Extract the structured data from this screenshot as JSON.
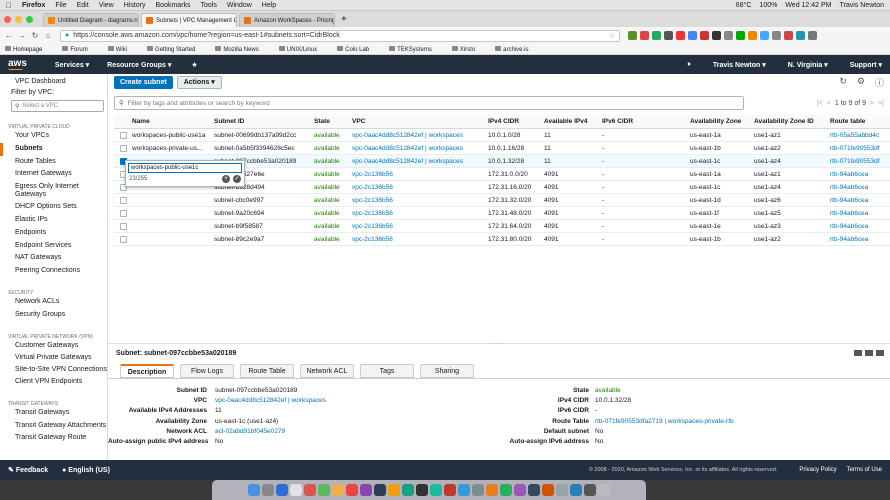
{
  "mac_menu": {
    "app": "Firefox",
    "items": [
      "File",
      "Edit",
      "View",
      "History",
      "Bookmarks",
      "Tools",
      "Window",
      "Help"
    ],
    "right": [
      "68°C",
      "100%",
      "Wed 12:42 PM",
      "Travis Newton"
    ]
  },
  "tabs": [
    {
      "label": "Untitled Diagram - diagrams.net",
      "color": "#f08705",
      "active": false
    },
    {
      "label": "Subnets | VPC Management Co",
      "color": "#ec7211",
      "active": true
    },
    {
      "label": "Amazon WorkSpaces - Pricing",
      "color": "#ec7211",
      "active": false
    }
  ],
  "url": "https://console.aws.amazon.com/vpc/home?region=us-east-1#subnets:sort=CidrBlock",
  "bookmarks": [
    "Homepage",
    "Forum",
    "Wiki",
    "Getting Started",
    "Mozilla News",
    "UNIX/Linux",
    "Colo Lab",
    "TEKSystems",
    "Xirsto",
    "archive.is"
  ],
  "aws_nav": {
    "services": "Services ▾",
    "resource_groups": "Resource Groups ▾",
    "user": "Travis Newton ▾",
    "region": "N. Virginia ▾",
    "support": "Support ▾"
  },
  "sidebar": {
    "dashboard": "VPC Dashboard",
    "filter_label": "Filter by VPC:",
    "select_placeholder": "Select a VPC",
    "sections": [
      {
        "title": "VIRTUAL PRIVATE CLOUD",
        "items": [
          {
            "label": "Your VPCs"
          },
          {
            "label": "Subnets",
            "active": true
          },
          {
            "label": "Route Tables"
          },
          {
            "label": "Internet Gateways"
          },
          {
            "label": "Egress Only Internet Gateways"
          },
          {
            "label": "DHCP Options Sets"
          },
          {
            "label": "Elastic IPs"
          },
          {
            "label": "Endpoints"
          },
          {
            "label": "Endpoint Services"
          },
          {
            "label": "NAT Gateways"
          },
          {
            "label": "Peering Connections"
          }
        ]
      },
      {
        "title": "SECURITY",
        "items": [
          {
            "label": "Network ACLs"
          },
          {
            "label": "Security Groups"
          }
        ]
      },
      {
        "title": "VIRTUAL PRIVATE NETWORK (VPN)",
        "items": [
          {
            "label": "Customer Gateways"
          },
          {
            "label": "Virtual Private Gateways"
          },
          {
            "label": "Site-to-Site VPN Connections"
          },
          {
            "label": "Client VPN Endpoints"
          }
        ]
      },
      {
        "title": "TRANSIT GATEWAYS",
        "items": [
          {
            "label": "Transit Gateways"
          },
          {
            "label": "Transit Gateway Attachments"
          },
          {
            "label": "Transit Gateway Route"
          }
        ]
      }
    ]
  },
  "actions": {
    "create": "Create subnet",
    "actions": "Actions ▾"
  },
  "search_placeholder": "Filter by tags and attributes or search by keyword",
  "pager": "1 to 9 of 9",
  "columns": [
    "Name",
    "Subnet ID",
    "State",
    "VPC",
    "IPv4 CIDR",
    "Available IPv4",
    "IPv6 CIDR",
    "Availability Zone",
    "Availability Zone ID",
    "Route table"
  ],
  "rows": [
    {
      "name": "workspaces-public-use1a",
      "id": "subnet-00699db137a99d2cc",
      "state": "available",
      "vpc": "vpc-0aac4dd8c512842ef | workspaces",
      "cidr": "10.0.1.0/28",
      "avail": "11",
      "ipv6": "-",
      "az": "us-east-1a",
      "azid": "use1-az1",
      "rt": "rtb-05a55abbd4c"
    },
    {
      "name": "workspaces-private-us...",
      "id": "subnet-0a5b5f3394628c5ec",
      "state": "available",
      "vpc": "vpc-0aac4dd8c512842ef | workspaces",
      "cidr": "10.0.1.16/28",
      "avail": "11",
      "ipv6": "-",
      "az": "us-east-1b",
      "azid": "use1-az2",
      "rt": "rtb-071fe90553df"
    },
    {
      "name": "",
      "id": "subnet-097ccbbe53a020189",
      "state": "available",
      "vpc": "vpc-0aac4dd8c512842ef | workspaces",
      "cidr": "10.0.1.32/28",
      "avail": "11",
      "ipv6": "-",
      "az": "us-east-1c",
      "azid": "use1-az4",
      "rt": "rtb-071fe90553df",
      "selected": true
    },
    {
      "name": "",
      "id": "subnet-29527e6e",
      "state": "available",
      "vpc": "vpc-2c136b56",
      "cidr": "172.31.0.0/20",
      "avail": "4091",
      "ipv6": "-",
      "az": "us-east-1a",
      "azid": "use1-az1",
      "rt": "rtb-94ab6cea"
    },
    {
      "name": "",
      "id": "subnet-d928d494",
      "state": "available",
      "vpc": "vpc-2c136b56",
      "cidr": "172.31.16.0/20",
      "avail": "4091",
      "ipv6": "-",
      "az": "us-east-1c",
      "azid": "use1-az4",
      "rt": "rtb-94ab6cea"
    },
    {
      "name": "",
      "id": "subnet-cbc0e997",
      "state": "available",
      "vpc": "vpc-2c136b56",
      "cidr": "172.31.32.0/20",
      "avail": "4091",
      "ipv6": "-",
      "az": "us-east-1d",
      "azid": "use1-az6",
      "rt": "rtb-94ab6cea"
    },
    {
      "name": "",
      "id": "subnet-9a20c694",
      "state": "available",
      "vpc": "vpc-2c136b56",
      "cidr": "172.31.48.0/20",
      "avail": "4091",
      "ipv6": "-",
      "az": "us-east-1f",
      "azid": "use1-az5",
      "rt": "rtb-94ab6cea"
    },
    {
      "name": "",
      "id": "subnet-b9f58587",
      "state": "available",
      "vpc": "vpc-2c136b56",
      "cidr": "172.31.64.0/20",
      "avail": "4091",
      "ipv6": "-",
      "az": "us-east-1e",
      "azid": "use1-az3",
      "rt": "rtb-94ab6cea"
    },
    {
      "name": "",
      "id": "subnet-89c2e9a7",
      "state": "available",
      "vpc": "vpc-2c136b56",
      "cidr": "172.31.80.0/20",
      "avail": "4091",
      "ipv6": "-",
      "az": "us-east-1b",
      "azid": "use1-az2",
      "rt": "rtb-94ab6cea"
    }
  ],
  "editor": {
    "value": "workspaces-public-use1c",
    "count": "23/255"
  },
  "detail": {
    "header": "Subnet: subnet-097ccbbe53a020189",
    "tabs": [
      "Description",
      "Flow Logs",
      "Route Table",
      "Network ACL",
      "Tags",
      "Sharing"
    ],
    "left": [
      {
        "k": "Subnet ID",
        "v": "subnet-097ccbbe53a020189"
      },
      {
        "k": "VPC",
        "v": "vpc-0aac4dd8c512842ef | workspaces",
        "link": true
      },
      {
        "k": "Available IPv4 Addresses",
        "v": "11"
      },
      {
        "k": "Availability Zone",
        "v": "us-east-1c (use1-az4)"
      },
      {
        "k": "Network ACL",
        "v": "acl-02abd91bf045e0279",
        "link": true
      },
      {
        "k": "Auto-assign public IPv4 address",
        "v": "No"
      }
    ],
    "right": [
      {
        "k": "State",
        "v": "available",
        "green": true
      },
      {
        "k": "IPv4 CIDR",
        "v": "10.0.1.32/28"
      },
      {
        "k": "IPv6 CIDR",
        "v": "-"
      },
      {
        "k": "Route Table",
        "v": "rtb-071fe90553dfa2719 | workspaces-private-rtb",
        "link": true
      },
      {
        "k": "Default subnet",
        "v": "No"
      },
      {
        "k": "Auto-assign IPv6 address",
        "v": "No"
      }
    ]
  },
  "footer": {
    "feedback": "Feedback",
    "language": "English (US)",
    "copyright": "© 2008 - 2020, Amazon Web Services, Inc. or its affiliates. All rights reserved.",
    "privacy": "Privacy Policy",
    "terms": "Terms of Use"
  },
  "dock_colors": [
    "#4a90e2",
    "#888",
    "#2b6fd6",
    "#e2e2e2",
    "#d9534f",
    "#5cb85c",
    "#f0ad4e",
    "#e44",
    "#8e44ad",
    "#2c3e50",
    "#f39c12",
    "#16a085",
    "#333",
    "#1abc9c",
    "#c0392b",
    "#3498db",
    "#7f8c8d",
    "#e67e22",
    "#27ae60",
    "#9b59b6",
    "#34495e",
    "#d35400",
    "#95a5a6",
    "#2980b9",
    "#555",
    "#bbb"
  ]
}
